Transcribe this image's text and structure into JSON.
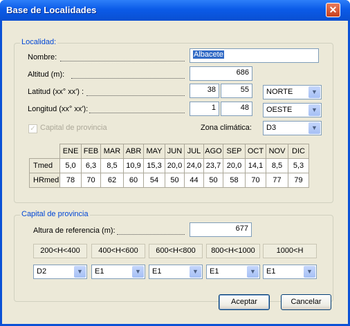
{
  "window": {
    "title": "Base de Localidades"
  },
  "localidad": {
    "group_label": "Localidad:",
    "nombre_label": "Nombre:",
    "nombre_value": "Albacete",
    "altitud_label": "Altitud (m):",
    "altitud_value": "686",
    "latitud_label": "Latitud (xx° xx') :",
    "latitud_deg": "38",
    "latitud_min": "55",
    "latitud_dir": "NORTE",
    "longitud_label": "Longitud (xx° xx'):",
    "longitud_deg": "1",
    "longitud_min": "48",
    "longitud_dir": "OESTE",
    "capital_label": "Capital de provincia",
    "zona_label": "Zona climática:",
    "zona_value": "D3"
  },
  "months_table": {
    "months": [
      "ENE",
      "FEB",
      "MAR",
      "ABR",
      "MAY",
      "JUN",
      "JUL",
      "AGO",
      "SEP",
      "OCT",
      "NOV",
      "DIC"
    ],
    "rows": [
      {
        "label": "Tmed",
        "values": [
          "5,0",
          "6,3",
          "8,5",
          "10,9",
          "15,3",
          "20,0",
          "24,0",
          "23,7",
          "20,0",
          "14,1",
          "8,5",
          "5,3"
        ]
      },
      {
        "label": "HRmed",
        "values": [
          "78",
          "70",
          "62",
          "60",
          "54",
          "50",
          "44",
          "50",
          "58",
          "70",
          "77",
          "79"
        ]
      }
    ]
  },
  "capital": {
    "group_label": "Capital de provincia",
    "altura_label": "Altura de referencia (m):",
    "altura_value": "677",
    "ranges": [
      "200<H<400",
      "400<H<600",
      "600<H<800",
      "800<H<1000",
      "1000<H"
    ],
    "zones": [
      "D2",
      "E1",
      "E1",
      "E1",
      "E1"
    ]
  },
  "buttons": {
    "accept": "Aceptar",
    "cancel": "Cancelar"
  },
  "icons": {
    "close": "close-icon",
    "dropdown": "chevron-down-icon",
    "checkbox": "check-icon"
  }
}
